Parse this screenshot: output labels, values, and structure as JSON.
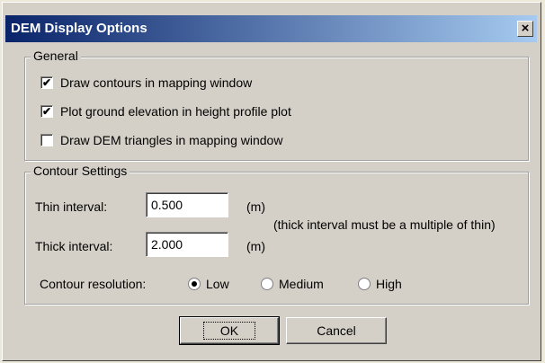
{
  "window": {
    "title": "DEM Display Options",
    "close_glyph": "×"
  },
  "general": {
    "legend": "General",
    "options": [
      {
        "label": "Draw contours in mapping window",
        "checked": true
      },
      {
        "label": "Plot ground elevation in height profile plot",
        "checked": true
      },
      {
        "label": "Draw DEM triangles in mapping window",
        "checked": false
      }
    ]
  },
  "contour": {
    "legend": "Contour Settings",
    "thin_label": "Thin interval:",
    "thin_value": "0.500",
    "thin_unit": "(m)",
    "thick_label": "Thick interval:",
    "thick_value": "2.000",
    "thick_unit": "(m)",
    "note": "(thick interval must be a multiple of thin)",
    "resolution_label": "Contour resolution:",
    "resolution_options": [
      "Low",
      "Medium",
      "High"
    ],
    "resolution_selected": "Low"
  },
  "buttons": {
    "ok": "OK",
    "cancel": "Cancel"
  }
}
